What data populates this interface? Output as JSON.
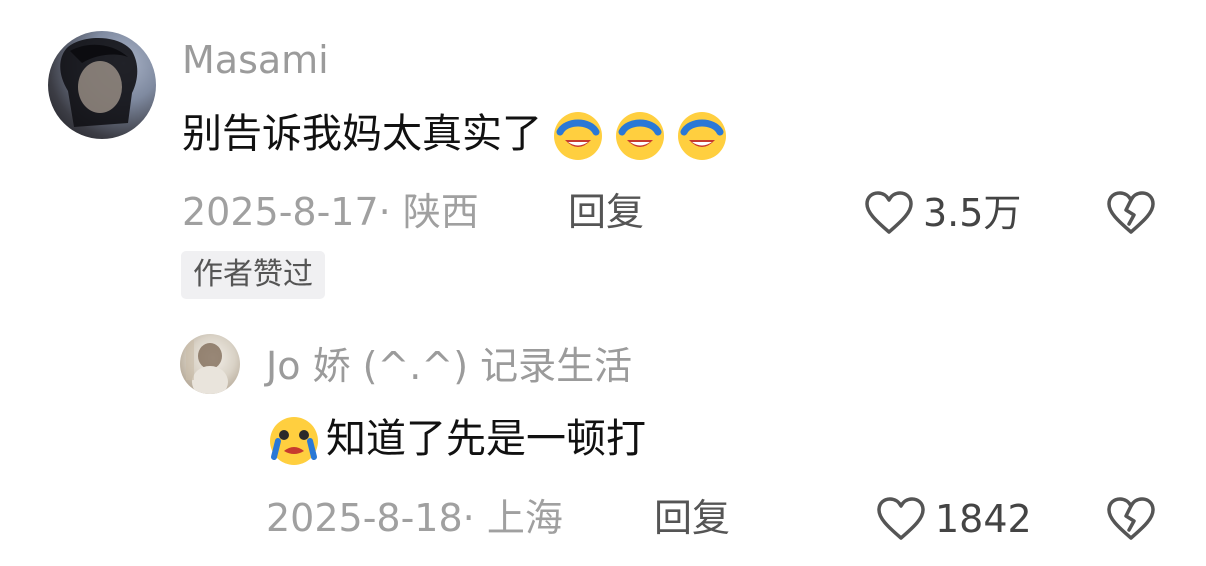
{
  "comments": [
    {
      "username": "Masami",
      "text": "别告诉我妈太真实了",
      "emojis": [
        "laugh-crying-emoji",
        "laugh-crying-emoji",
        "laugh-crying-emoji"
      ],
      "date_location": "2025-8-17· 陕西",
      "reply_label": "回复",
      "likes": "3.5万",
      "badge": "作者赞过"
    },
    {
      "username": "Jo 娇 (^.^) 记录生活",
      "text": "知道了先是一顿打",
      "emojis": [
        "crying-emoji"
      ],
      "date_location": "2025-8-18· 上海",
      "reply_label": "回复",
      "likes": "1842"
    }
  ],
  "icons": {
    "like": "heart-outline-icon",
    "dislike": "broken-heart-icon"
  },
  "colors": {
    "username": "#9b9b9b",
    "text": "#111111",
    "meta": "#a0a0a0",
    "badge_bg": "#f0f0f2"
  }
}
